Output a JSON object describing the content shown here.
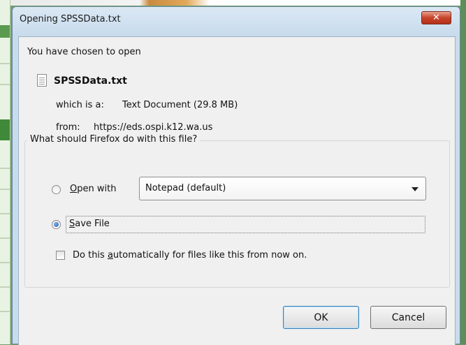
{
  "dialog": {
    "title": "Opening SPSSData.txt",
    "close_glyph": "✕",
    "intro": "You have chosen to open",
    "file_name": "SPSSData.txt",
    "type_label": "which is a:",
    "type_value": "Text Document (29.8  MB)",
    "from_label": "from:",
    "from_value": "https://eds.ospi.k12.wa.us",
    "group_label": "What should Firefox do with this file?",
    "open_with": {
      "mnemonic": "O",
      "rest": "pen with",
      "selected": false
    },
    "app_select": {
      "value": "Notepad (default)"
    },
    "save_file": {
      "mnemonic": "S",
      "rest": "ave File",
      "selected": true
    },
    "auto": {
      "before": "Do this ",
      "mnemonic": "a",
      "rest": "utomatically for files like this from now on.",
      "checked": false
    },
    "ok_label": "OK",
    "cancel_label": "Cancel"
  }
}
